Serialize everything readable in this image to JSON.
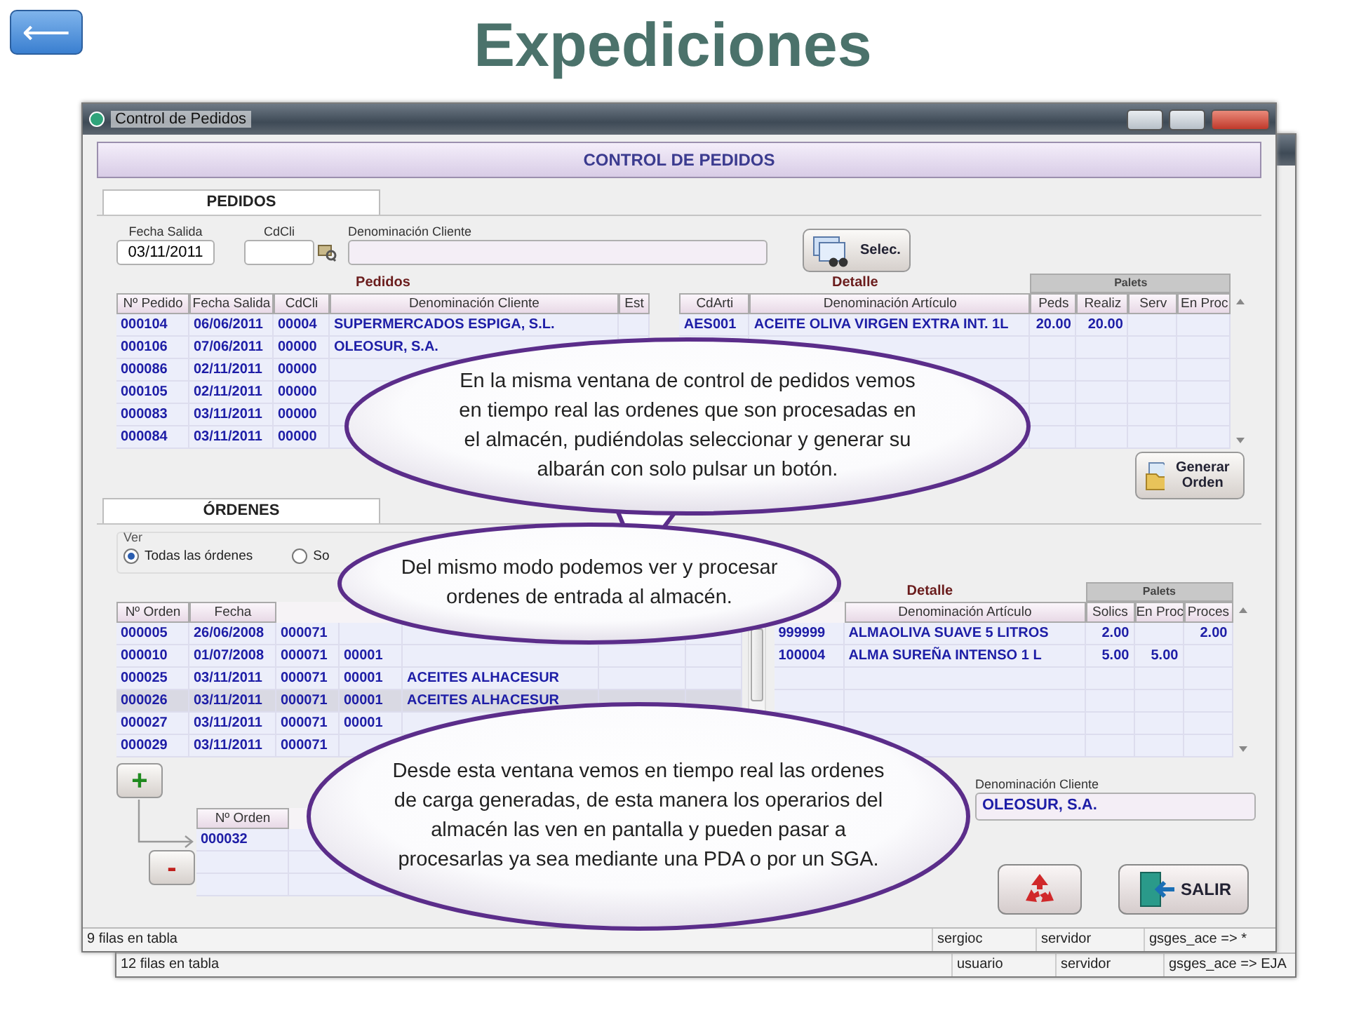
{
  "slide": {
    "back_button": "⟵",
    "title": "Expediciones"
  },
  "back_window": {
    "status_bar": [
      "12 filas en tabla",
      "usuario",
      "servidor",
      "gsges_ace => EJA"
    ]
  },
  "window": {
    "title": "Control de Pedidos",
    "header": "CONTROL DE PEDIDOS",
    "pedidos": {
      "section": "PEDIDOS",
      "fecha": {
        "label": "Fecha Salida",
        "value": "03/11/2011"
      },
      "cdcli": {
        "label": "CdCli"
      },
      "cliente": {
        "label": "Denominación Cliente"
      },
      "select_button": "Selec.",
      "orders_table": {
        "caption": "Pedidos",
        "columns": [
          "Nº Pedido",
          "Fecha Salida",
          "CdCli",
          "Denominación Cliente",
          "Est"
        ],
        "rows": [
          [
            "000104",
            "06/06/2011",
            "00004",
            "SUPERMERCADOS ESPIGA, S.L.",
            null
          ],
          [
            "000106",
            "07/06/2011",
            "00000",
            "OLEOSUR, S.A.",
            null
          ],
          [
            "000086",
            "02/11/2011",
            "00000",
            null,
            null
          ],
          [
            "000105",
            "02/11/2011",
            "00000",
            null,
            null
          ],
          [
            "000083",
            "03/11/2011",
            "00000",
            null,
            null
          ],
          [
            "000084",
            "03/11/2011",
            "00000",
            null,
            null
          ]
        ]
      },
      "detail_table": {
        "caption": "Detalle",
        "group": "Palets",
        "columns": [
          "CdArti",
          "Denominación Artículo",
          "Peds",
          "Realiz",
          "Serv",
          "En Proc"
        ],
        "rows": [
          [
            "AES001",
            "ACEITE OLIVA VIRGEN EXTRA INT. 1L",
            "20.00",
            "20.00",
            null,
            null
          ]
        ]
      },
      "generate_button": "Generar Orden"
    },
    "ordenes": {
      "section": "ÓRDENES",
      "filter": {
        "label": "Ver",
        "options": [
          {
            "label": "Todas las órdenes",
            "selected": true
          },
          {
            "label": "So",
            "selected": false
          }
        ]
      },
      "orders_table": {
        "columns": [
          "Nº Orden",
          "Fecha",
          null,
          null,
          null,
          null,
          null
        ],
        "rows": [
          {
            "cells": [
              "000005",
              "26/06/2008",
              "000071"
            ],
            "selected": false
          },
          {
            "cells": [
              "000010",
              "01/07/2008",
              "000071",
              "00001"
            ],
            "selected": false
          },
          {
            "cells": [
              "000025",
              "03/11/2011",
              "000071",
              "00001",
              "ACEITES ALHACESUR"
            ],
            "selected": false
          },
          {
            "cells": [
              "000026",
              "03/11/2011",
              "000071",
              "00001",
              "ACEITES ALHACESUR"
            ],
            "selected": true
          },
          {
            "cells": [
              "000027",
              "03/11/2011",
              "000071",
              "00001"
            ],
            "selected": false
          },
          {
            "cells": [
              "000029",
              "03/11/2011",
              "000071"
            ],
            "selected": false
          }
        ]
      },
      "detail_table": {
        "caption": "Detalle",
        "group": "Palets",
        "columns": [
          null,
          "Denominación Artículo",
          "Solics",
          "En Proc",
          "Proces"
        ],
        "rows": [
          [
            "999999",
            "ALMAOLIVA SUAVE 5 LITROS",
            "2.00",
            null,
            "2.00"
          ],
          [
            "100004",
            "ALMA SUREÑA INTENSO 1 L",
            "5.00",
            "5.00",
            null
          ]
        ]
      },
      "add_button": "+",
      "remove_button": "-",
      "albaranar_table": {
        "columns": [
          "Nº Orden",
          null,
          null
        ],
        "rows": [
          [
            "000032"
          ]
        ]
      },
      "cliente": {
        "label": "Denominación Cliente",
        "value": "OLEOSUR, S.A."
      },
      "exit_button": "SALIR"
    },
    "status_bar": [
      "9 filas en tabla",
      "sergioc",
      "servidor",
      "gsges_ace => *"
    ]
  },
  "callouts": [
    {
      "text": "En la misma ventana de control de pedidos vemos en tiempo real las ordenes que son procesadas en el almacén, pudiéndolas seleccionar y generar su albarán con solo pulsar un botón."
    },
    {
      "text": "Del mismo modo podemos ver y procesar ordenes de entrada al almacén."
    },
    {
      "text": "Desde esta ventana vemos en tiempo real las ordenes de carga generadas, de esta manera los operarios del almacén las ven en pantalla y pueden pasar a procesarlas ya sea mediante una PDA o por un SGA."
    }
  ]
}
